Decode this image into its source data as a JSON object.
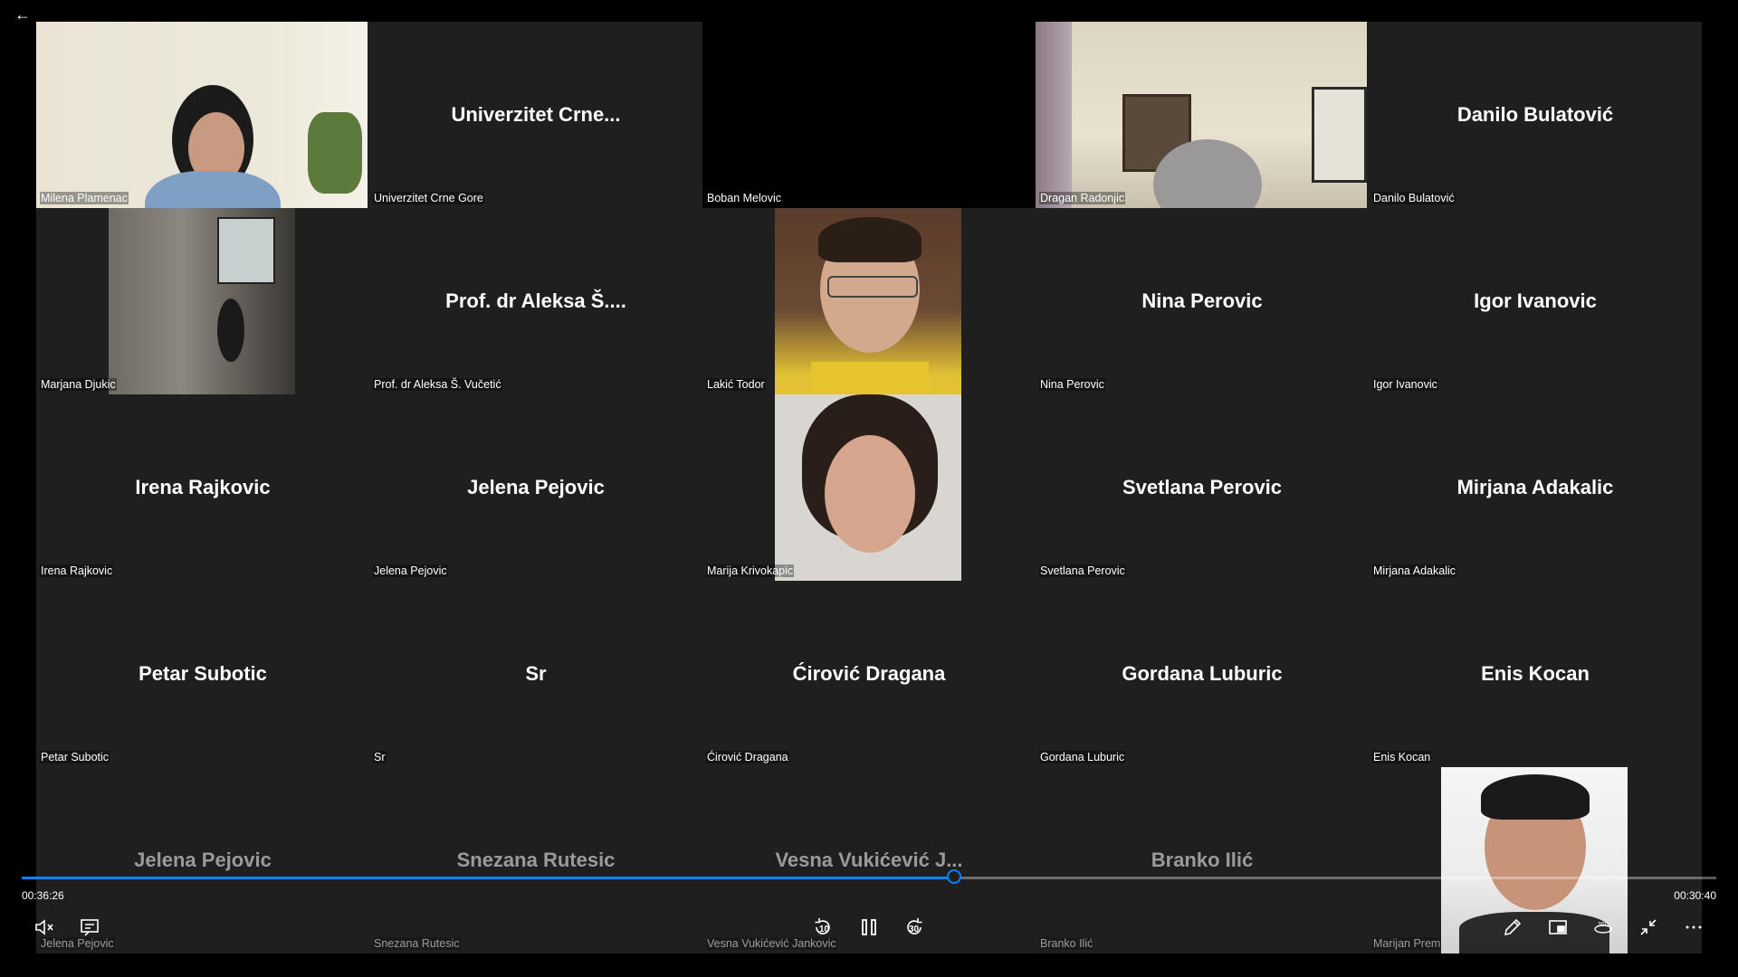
{
  "nav": {
    "back_icon": "arrow-left-icon"
  },
  "tiles": [
    {
      "big": "",
      "small": "Milena Plamenac",
      "video": true
    },
    {
      "big": "Univerzitet  Crne...",
      "small": "Univerzitet Crne Gore",
      "video": false
    },
    {
      "big": "",
      "small": "Boban Melovic",
      "video": false
    },
    {
      "big": "",
      "small": "Dragan Radonjic",
      "video": true
    },
    {
      "big": "Danilo Bulatović",
      "small": "Danilo Bulatović",
      "video": false
    },
    {
      "big": "",
      "small": "Marjana Djukic",
      "video": true
    },
    {
      "big": "Prof. dr Aleksa Š....",
      "small": "Prof. dr Aleksa Š. Vučetić",
      "video": false
    },
    {
      "big": "",
      "small": "Lakić Todor",
      "video": true
    },
    {
      "big": "Nina Perovic",
      "small": "Nina Perovic",
      "video": false
    },
    {
      "big": "Igor Ivanovic",
      "small": "Igor Ivanovic",
      "video": false
    },
    {
      "big": "Irena Rajkovic",
      "small": "Irena Rajkovic",
      "video": false
    },
    {
      "big": "Jelena Pejovic",
      "small": "Jelena Pejovic",
      "video": false
    },
    {
      "big": "",
      "small": "Marija Krivokapic",
      "video": true
    },
    {
      "big": "Svetlana Perovic",
      "small": "Svetlana Perovic",
      "video": false
    },
    {
      "big": "Mirjana Adakalic",
      "small": "Mirjana Adakalic",
      "video": false
    },
    {
      "big": "Petar Subotic",
      "small": "Petar Subotic",
      "video": false
    },
    {
      "big": "Sr",
      "small": "Sr",
      "video": false
    },
    {
      "big": "Ćirović Dragana",
      "small": "Ćirović Dragana",
      "video": false
    },
    {
      "big": "Gordana Luburic",
      "small": "Gordana Luburic",
      "video": false
    },
    {
      "big": "Enis Kocan",
      "small": "Enis Kocan",
      "video": false
    },
    {
      "big": "Jelena Pejovic",
      "small": "Jelena Pejovic",
      "video": false
    },
    {
      "big": "Snezana Rutesic",
      "small": "Snezana Rutesic",
      "video": false
    },
    {
      "big": "Vesna Vukićević J...",
      "small": "Vesna Vukićević Jankovic",
      "video": false
    },
    {
      "big": "Branko Ilić",
      "small": "Branko Ilić",
      "video": false
    },
    {
      "big": "",
      "small": "Marijan Premovic",
      "video": true
    }
  ],
  "player": {
    "elapsed": "00:36:26",
    "remaining": "00:30:40",
    "progress_fraction": 0.55,
    "seek_back_label": "10",
    "seek_forward_label": "30",
    "accent_color": "#0a84ff",
    "icons": {
      "mute": "mute-icon",
      "captions": "captions-icon",
      "seek_back": "seek-back-icon",
      "pause": "pause-icon",
      "seek_forward": "seek-forward-icon",
      "pen": "pen-icon",
      "miniplayer": "miniplayer-icon",
      "view360": "360-view-icon",
      "exit_fullscreen": "exit-fullscreen-icon",
      "more": "more-icon"
    }
  }
}
